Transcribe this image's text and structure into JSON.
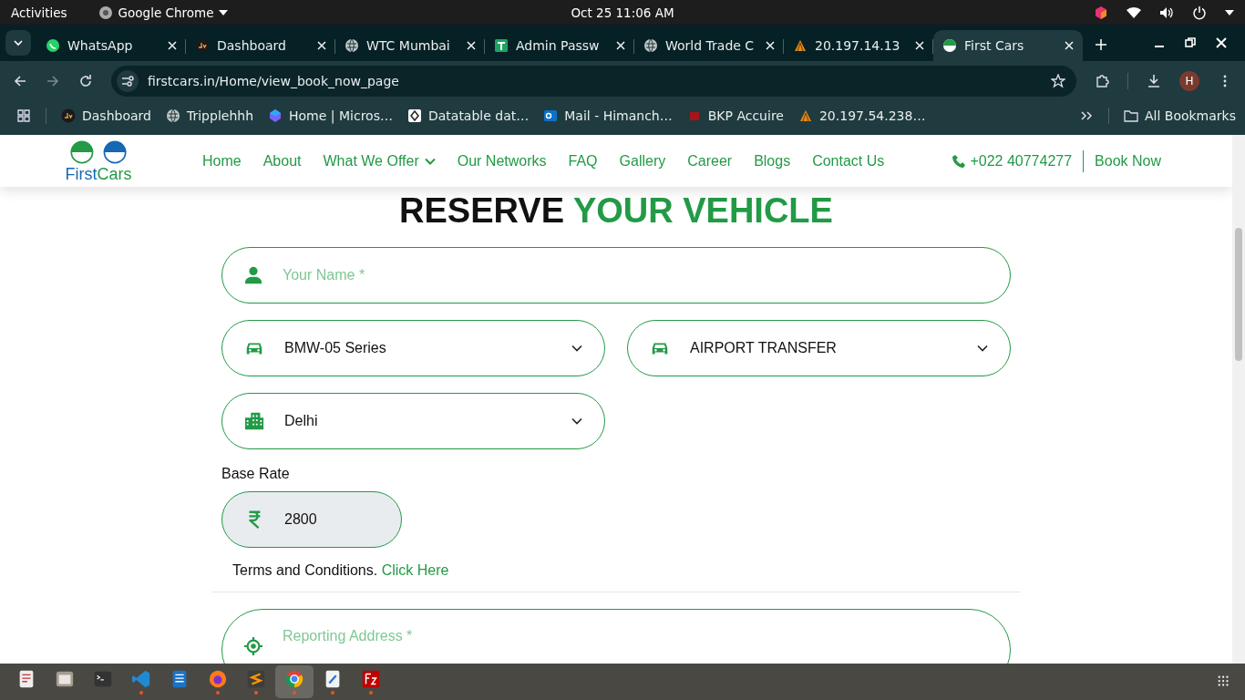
{
  "system_bar": {
    "activities": "Activities",
    "app_menu": "Google Chrome",
    "clock": "Oct 25  11:06 AM"
  },
  "tabs": [
    {
      "label": "WhatsApp",
      "kind": "whatsapp",
      "selected": false
    },
    {
      "label": "Dashboard",
      "kind": "dv",
      "selected": false
    },
    {
      "label": "WTC Mumbai",
      "kind": "globe",
      "selected": false
    },
    {
      "label": "Admin Passw",
      "kind": "sheet",
      "selected": false
    },
    {
      "label": "World Trade C",
      "kind": "globe",
      "selected": false
    },
    {
      "label": "20.197.14.13",
      "kind": "tower",
      "selected": false
    },
    {
      "label": "First Cars",
      "kind": "firstcars",
      "selected": true
    }
  ],
  "address_bar": {
    "url": "firstcars.in/Home/view_book_now_page"
  },
  "profile": {
    "initial": "H"
  },
  "bookmarks": [
    {
      "label": "Dashboard",
      "kind": "dv"
    },
    {
      "label": "Tripplehhh",
      "kind": "globe"
    },
    {
      "label": "Home | Micros…",
      "kind": "ms"
    },
    {
      "label": "Datatable dat…",
      "kind": "dt"
    },
    {
      "label": "Mail - Himanch…",
      "kind": "mail"
    },
    {
      "label": "BKP Accuire",
      "kind": "red"
    },
    {
      "label": "20.197.54.238…",
      "kind": "tower"
    }
  ],
  "all_bookmarks": "All Bookmarks",
  "site_nav": {
    "logo_first": "First",
    "logo_second": "Cars",
    "links": [
      {
        "label": "Home",
        "dropdown": false
      },
      {
        "label": "About",
        "dropdown": false
      },
      {
        "label": "What We Offer",
        "dropdown": true
      },
      {
        "label": "Our Networks",
        "dropdown": false
      },
      {
        "label": "FAQ",
        "dropdown": false
      },
      {
        "label": "Gallery",
        "dropdown": false
      },
      {
        "label": "Career",
        "dropdown": false
      },
      {
        "label": "Blogs",
        "dropdown": false
      },
      {
        "label": "Contact Us",
        "dropdown": false
      }
    ],
    "phone": "+022 40774277",
    "book_now": "Book Now"
  },
  "heading": {
    "dark": "RESERVE",
    "accent": "YOUR VEHICLE"
  },
  "form": {
    "name": {
      "placeholder": "Your Name *"
    },
    "car": {
      "value": "BMW-05 Series"
    },
    "service": {
      "value": "AIRPORT TRANSFER"
    },
    "city": {
      "value": "Delhi"
    },
    "base_rate_label": "Base Rate",
    "base_rate": {
      "value": "2800"
    },
    "terms": "Terms and Conditions.",
    "terms_link": "Click Here",
    "address": {
      "placeholder": "Reporting Address *"
    }
  },
  "taskbar": [
    {
      "kind": "viewer",
      "running": false,
      "selected": false
    },
    {
      "kind": "files",
      "running": false,
      "selected": false
    },
    {
      "kind": "terminal",
      "running": false,
      "selected": false
    },
    {
      "kind": "vscode",
      "running": true,
      "selected": false
    },
    {
      "kind": "writer",
      "running": false,
      "selected": false
    },
    {
      "kind": "firefox",
      "running": true,
      "selected": false
    },
    {
      "kind": "sublime",
      "running": true,
      "selected": false
    },
    {
      "kind": "chrome",
      "running": true,
      "selected": true
    },
    {
      "kind": "notes",
      "running": true,
      "selected": false
    },
    {
      "kind": "filezilla",
      "running": true,
      "selected": false
    }
  ]
}
